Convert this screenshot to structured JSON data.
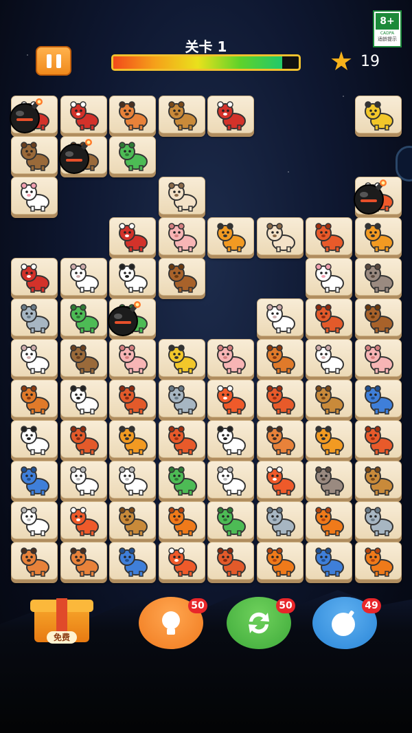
{
  "header": {
    "level_label": "关卡 1",
    "progress": 0.91,
    "stars": "19"
  },
  "rating": {
    "age": "8+",
    "org": "CADPA",
    "tip": "适龄提示"
  },
  "board": {
    "colors": {
      "tile": "#f4e6c9",
      "tile_shadow": "#b08d5f"
    },
    "rows": [
      [
        "gorilla",
        "gorilla",
        "raccoon",
        "deer",
        "gorilla",
        null,
        null,
        "leopard"
      ],
      [
        "bear",
        "bear",
        "triceratops",
        null,
        null,
        null,
        null,
        null
      ],
      [
        "rabbit",
        null,
        null,
        "monkey",
        null,
        null,
        null,
        "fox"
      ],
      [
        null,
        null,
        "gorilla",
        "pig",
        "tiger",
        "monkey",
        "squirrel",
        "tiger"
      ],
      [
        "gorilla",
        "sheep",
        "panda",
        "bull",
        null,
        null,
        "rabbit",
        "koala"
      ],
      [
        "elephant",
        "triceratops",
        "triceratops",
        null,
        null,
        "sheep",
        "hedgehog",
        "bull"
      ],
      [
        "sheep",
        "bear",
        "pig",
        "leopard",
        "pig",
        "horse",
        "sheep",
        "pig"
      ],
      [
        "horse",
        "panda",
        "hedgehog",
        "elephant",
        "fox",
        "squirrel",
        "deer",
        "rhino"
      ],
      [
        "panda",
        "hedgehog",
        "tiger",
        "squirrel",
        "panda",
        "raccoon",
        "tiger",
        "squirrel"
      ],
      [
        "rhino",
        "polar-bear",
        "polar-bear",
        "triceratops",
        "polar-bear",
        "fox",
        "koala",
        "deer"
      ],
      [
        "polar-bear",
        "fox",
        "deer",
        "lion",
        "triceratops",
        "elephant",
        "lion",
        "elephant"
      ],
      [
        "raccoon",
        "raccoon",
        "rhino",
        "fox",
        "hedgehog",
        "lion",
        "rhino",
        "lion"
      ]
    ],
    "bombs": [
      {
        "row": 0,
        "col": 0
      },
      {
        "row": 1,
        "col": 1
      },
      {
        "row": 2,
        "col": 7
      },
      {
        "row": 5,
        "col": 2
      }
    ]
  },
  "powerups": {
    "gift": {
      "label": "免费"
    },
    "hint": {
      "icon": "lightbulb-icon",
      "count": "50",
      "color": "#f07a1e"
    },
    "shuffle": {
      "icon": "shuffle-icon",
      "count": "50",
      "color": "#3eaa3a"
    },
    "bomb": {
      "icon": "bomb-icon",
      "count": "49",
      "color": "#2a86d8"
    }
  }
}
